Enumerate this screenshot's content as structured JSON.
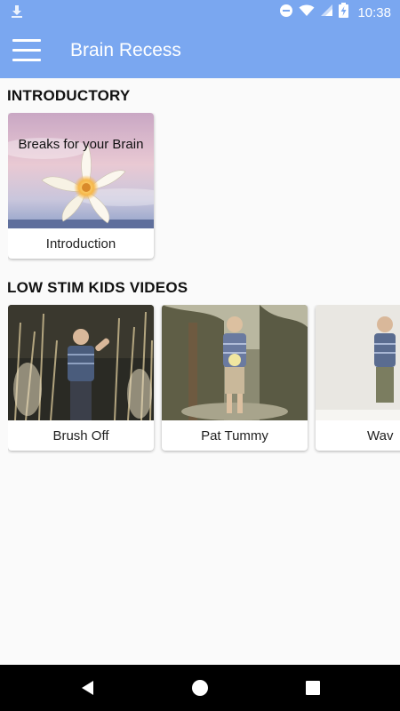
{
  "status_bar": {
    "time": "10:38",
    "icons": [
      "download-icon",
      "dnd-icon",
      "wifi-icon",
      "signal-icon",
      "battery-charging-icon"
    ]
  },
  "app_bar": {
    "title": "Brain Recess",
    "menu_icon": "hamburger-menu-icon"
  },
  "sections": [
    {
      "title": "INTRODUCTORY",
      "cards": [
        {
          "label": "Introduction",
          "thumb_text": "Breaks for your Brain"
        }
      ]
    },
    {
      "title": "LOW STIM KIDS VIDEOS",
      "cards": [
        {
          "label": "Brush Off"
        },
        {
          "label": "Pat Tummy"
        },
        {
          "label": "Wav"
        }
      ]
    }
  ],
  "nav_bar": {
    "buttons": [
      "back-icon",
      "home-icon",
      "recents-icon"
    ]
  },
  "colors": {
    "app_bar": "#7aa7f0",
    "background": "#fafafa",
    "nav_bar": "#000000"
  }
}
